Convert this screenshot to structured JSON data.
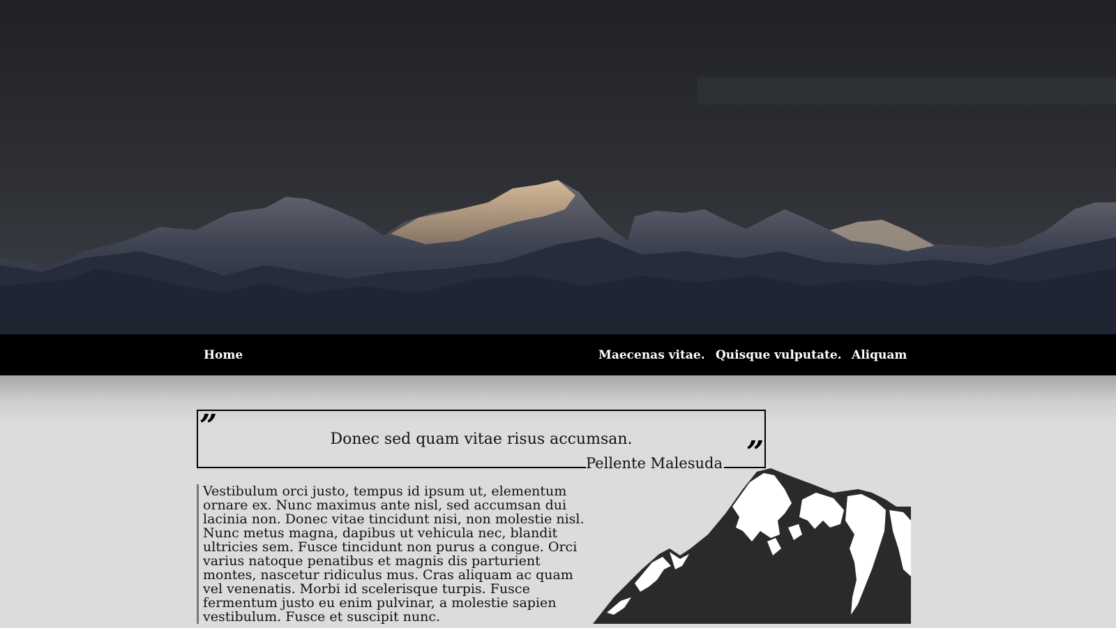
{
  "hero": {
    "image": "mountain-range-photo",
    "colors": {
      "sky": "#2b2d31",
      "snow_lit": "#c9ab88",
      "rock": "#262c3a"
    }
  },
  "nav": {
    "home": "Home",
    "items": [
      "Maecenas vitae.",
      "Quisque vulputate.",
      "Aliquam"
    ]
  },
  "quote": {
    "open_mark": "”",
    "close_mark": "”",
    "text": "Donec sed quam vitae risus accumsan.",
    "author": "Pellente Malesuda"
  },
  "article": {
    "body": "Vestibulum orci justo, tempus id ipsum ut, elementum ornare ex. Nunc maximus ante nisl, sed accumsan dui lacinia non. Donec vitae tincidunt nisi, non molestie nisl. Nunc metus magna, dapibus ut vehicula nec, blandit ultricies sem. Fusce tincidunt non purus a congue. Orci varius natoque penatibus et magnis dis parturient montes, nascetur ridiculus mus. Cras aliquam ac quam vel venenatis. Morbi id scelerisque turpis. Fusce fermentum justo eu enim pulvinar, a molestie sapien vestibulum. Fusce et suscipit nunc."
  },
  "illustration": {
    "icon": "mountain-illustration-icon"
  }
}
